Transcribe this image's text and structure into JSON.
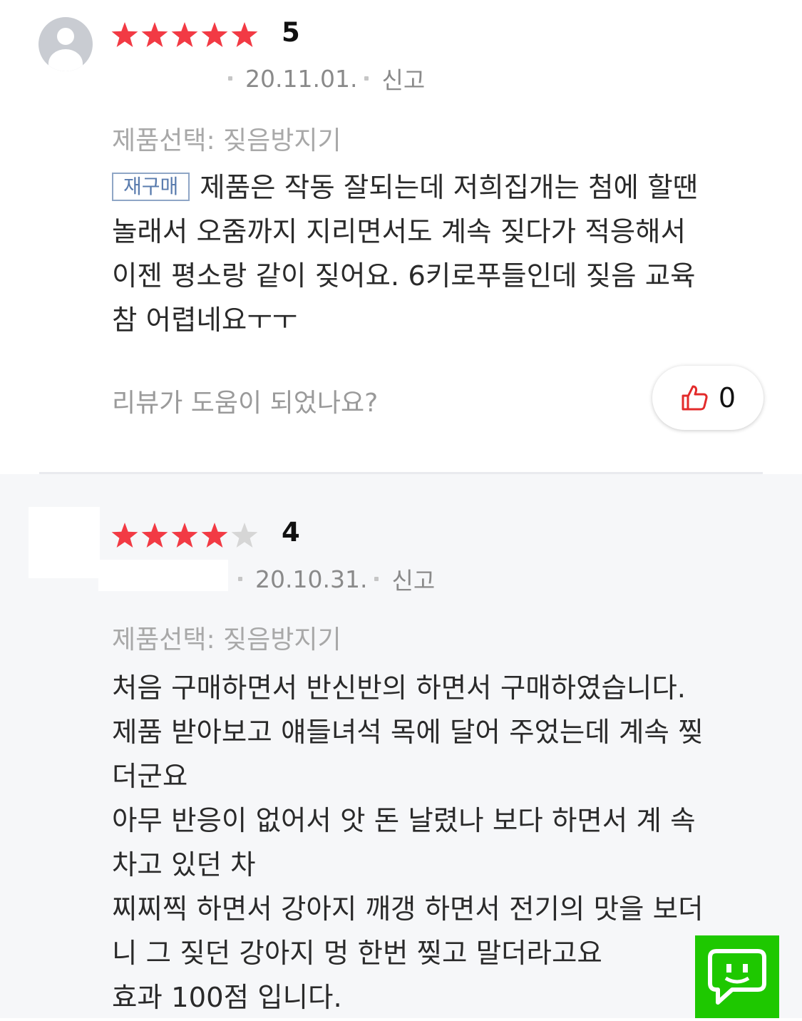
{
  "colors": {
    "star_filled": "#f23a44",
    "star_empty": "#d6d6d6",
    "badge_border": "#8fa6c6",
    "chat_green": "#1ec800",
    "like_icon": "#e32b2b"
  },
  "reviews": [
    {
      "rating": 5,
      "rating_label": "5",
      "date": "20.11.01.",
      "report_label": "신고",
      "option": "제품선택: 짖음방지기",
      "badge": "재구매",
      "lines": [
        "제품은 작동 잘되는데 저희집개는 첨에 할땐",
        "놀래서 오줌까지 지리면서도 계속 짖다가 적응해서",
        "이젠 평소랑 같이 짖어요. 6키로푸들인데 짖음 교육",
        "참 어렵네요ㅜㅜ"
      ],
      "helpful_question": "리뷰가 도움이 되었나요?",
      "like_count": "0",
      "icons": {
        "avatar": "user-avatar-icon",
        "like": "thumbs-up-icon"
      }
    },
    {
      "rating": 4,
      "rating_label": "4",
      "date": "20.10.31.",
      "report_label": "신고",
      "option": "제품선택: 짖음방지기",
      "lines": [
        "처음 구매하면서 반신반의 하면서 구매하였습니다.",
        "제품 받아보고 얘들녀석 목에 달어 주었는데 계속 찢",
        "더군요",
        "아무 반응이 없어서 앗 돈 날렸나 보다 하면서 계 속",
        "차고 있던 차",
        "찌찌찍 하면서 강아지 깨갱 하면서 전기의 맛을 보더",
        "니 그 짖던 강아지 멍 한번 찢고 말더라고요",
        "효과 100점 입니다."
      ]
    }
  ],
  "chat_button": {
    "icon": "chat-bubble-icon"
  }
}
